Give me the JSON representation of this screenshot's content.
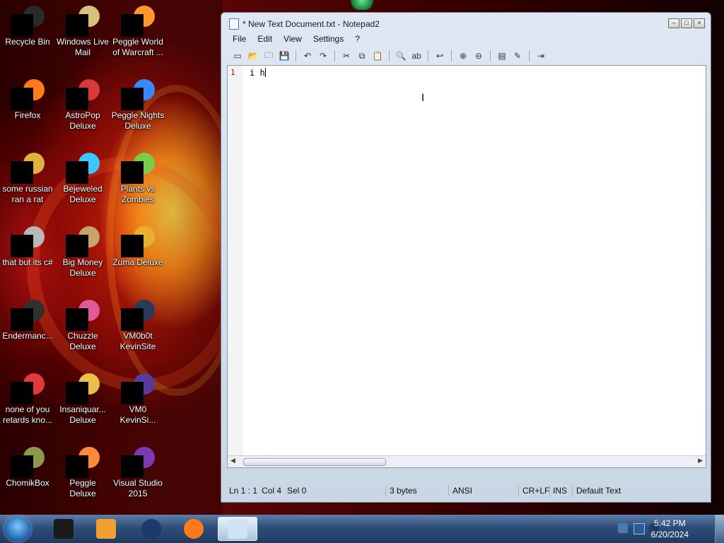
{
  "desktop": {
    "icons": [
      {
        "id": "recycle-bin",
        "label": "Recycle Bin",
        "col": 0,
        "row": 0,
        "color": "#2a2a2a"
      },
      {
        "id": "windows-live-mail",
        "label": "Windows Live Mail",
        "col": 1,
        "row": 0,
        "color": "#d8c27a"
      },
      {
        "id": "peggle-world-of-warcraft",
        "label": "Peggle World of Warcraft ...",
        "col": 2,
        "row": 0,
        "color": "#ff9a2a"
      },
      {
        "id": "firefox",
        "label": "Firefox",
        "col": 0,
        "row": 1,
        "color": "#ff7b1a"
      },
      {
        "id": "astropop-deluxe",
        "label": "AstroPop Deluxe",
        "col": 1,
        "row": 1,
        "color": "#d83a3a"
      },
      {
        "id": "peggle-nights-deluxe",
        "label": "Peggle Nights Deluxe",
        "col": 2,
        "row": 1,
        "color": "#3a88ff"
      },
      {
        "id": "some-russian-ran-a-rat",
        "label": "some russian ran a rat",
        "col": 0,
        "row": 2,
        "color": "#e0b23a"
      },
      {
        "id": "bejeweled-deluxe",
        "label": "Bejeweled Deluxe",
        "col": 1,
        "row": 2,
        "color": "#3ac8ff"
      },
      {
        "id": "plants-vs-zombies",
        "label": "Plants vs Zombies",
        "col": 2,
        "row": 2,
        "color": "#7acc4a"
      },
      {
        "id": "that-but-its-csharp",
        "label": "that but its c#",
        "col": 0,
        "row": 3,
        "color": "#b8b8b8"
      },
      {
        "id": "big-money-deluxe",
        "label": "Big Money Deluxe",
        "col": 1,
        "row": 3,
        "color": "#c8a26a"
      },
      {
        "id": "zuma-deluxe",
        "label": "Zuma Deluxe",
        "col": 2,
        "row": 3,
        "color": "#e6b030"
      },
      {
        "id": "endermanc",
        "label": "Endermanc...",
        "col": 0,
        "row": 4,
        "color": "#303030"
      },
      {
        "id": "chuzzle-deluxe",
        "label": "Chuzzle Deluxe",
        "col": 1,
        "row": 4,
        "color": "#e05a9a"
      },
      {
        "id": "vm0b0t-kevinsite",
        "label": "VM0b0t KevinSite",
        "col": 2,
        "row": 4,
        "color": "#2a3a5a"
      },
      {
        "id": "none-of-you",
        "label": "none of you retards kno...",
        "col": 0,
        "row": 5,
        "color": "#e23a3a"
      },
      {
        "id": "insaniquarium-deluxe",
        "label": "Insaniquar... Deluxe",
        "col": 1,
        "row": 5,
        "color": "#e8c04a"
      },
      {
        "id": "vm0-kevinsi",
        "label": "VM0 KevinSi...",
        "col": 2,
        "row": 5,
        "color": "#5a3a9a"
      },
      {
        "id": "chomikbox",
        "label": "ChomikBox",
        "col": 0,
        "row": 6,
        "color": "#8a9a4a"
      },
      {
        "id": "peggle-deluxe",
        "label": "Peggle Deluxe",
        "col": 1,
        "row": 6,
        "color": "#ff8a3a"
      },
      {
        "id": "visual-studio-2015",
        "label": "Visual Studio 2015",
        "col": 2,
        "row": 6,
        "color": "#7a3ab8"
      }
    ]
  },
  "notepad": {
    "title": "* New Text Document.txt - Notepad2",
    "menu": [
      "File",
      "Edit",
      "View",
      "Settings",
      "?"
    ],
    "toolbar": [
      {
        "name": "new-icon",
        "glyph": "▭"
      },
      {
        "name": "open-icon",
        "glyph": "📂"
      },
      {
        "name": "browse-icon",
        "glyph": "🗀"
      },
      {
        "name": "save-icon",
        "glyph": "💾"
      },
      {
        "sep": true
      },
      {
        "name": "undo-icon",
        "glyph": "↶"
      },
      {
        "name": "redo-icon",
        "glyph": "↷"
      },
      {
        "sep": true
      },
      {
        "name": "cut-icon",
        "glyph": "✂"
      },
      {
        "name": "copy-icon",
        "glyph": "⧉"
      },
      {
        "name": "paste-icon",
        "glyph": "📋"
      },
      {
        "sep": true
      },
      {
        "name": "find-icon",
        "glyph": "🔍"
      },
      {
        "name": "replace-icon",
        "glyph": "ab"
      },
      {
        "sep": true
      },
      {
        "name": "word-wrap-icon",
        "glyph": "↩"
      },
      {
        "sep": true
      },
      {
        "name": "zoom-in-icon",
        "glyph": "⊕"
      },
      {
        "name": "zoom-out-icon",
        "glyph": "⊖"
      },
      {
        "sep": true
      },
      {
        "name": "scheme-icon",
        "glyph": "▤"
      },
      {
        "name": "customize-scheme-icon",
        "glyph": "✎"
      },
      {
        "sep": true
      },
      {
        "name": "exit-icon",
        "glyph": "⇥"
      }
    ],
    "line_number": "1",
    "text": "i h",
    "status": {
      "ln": "Ln 1 : 1",
      "col": "Col 4",
      "sel": "Sel 0",
      "bytes": "3 bytes",
      "encoding": "ANSI",
      "eol": "CR+LF",
      "mode": "INS",
      "scheme": "Default Text"
    }
  },
  "taskbar": {
    "apps": [
      {
        "name": "taskbar-app-1",
        "color": "#1a1a1a"
      },
      {
        "name": "taskbar-media-player",
        "color": "#f0a030"
      },
      {
        "name": "taskbar-app-globe",
        "color": "#1a3a6a"
      },
      {
        "name": "taskbar-firefox",
        "color": "#ff7b1a"
      },
      {
        "name": "taskbar-notepad2",
        "color": "#cfe3f5"
      }
    ],
    "time": "5:42 PM",
    "date": "6/20/2024"
  }
}
